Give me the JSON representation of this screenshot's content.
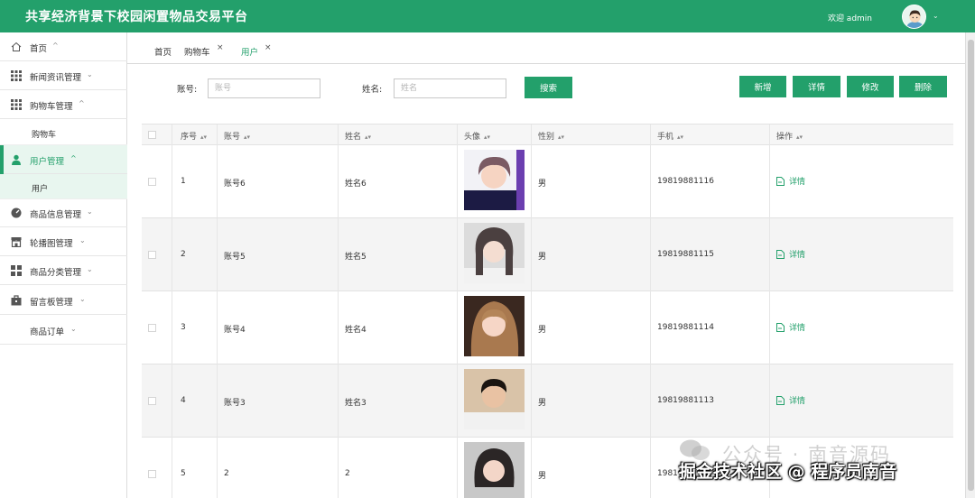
{
  "app": {
    "title": "共享经济背景下校园闲置物品交易平台",
    "welcome": "欢迎 admin"
  },
  "sidebar": {
    "items": [
      {
        "label": "首页",
        "icon": "home-icon",
        "chevron": "^"
      },
      {
        "label": "新闻资讯管理",
        "icon": "grid-icon",
        "chevron": "v"
      },
      {
        "label": "购物车管理",
        "icon": "grid-icon",
        "chevron": "^"
      },
      {
        "label": "用户管理",
        "icon": "user-icon",
        "chevron": "^"
      },
      {
        "label": "商品信息管理",
        "icon": "dashboard-icon",
        "chevron": "v"
      },
      {
        "label": "轮播图管理",
        "icon": "store-icon",
        "chevron": "v"
      },
      {
        "label": "商品分类管理",
        "icon": "tiles-icon",
        "chevron": "v"
      },
      {
        "label": "留言板管理",
        "icon": "briefcase-icon",
        "chevron": "v"
      },
      {
        "label": "商品订单",
        "icon": "",
        "chevron": "v"
      }
    ],
    "subitems": {
      "cart": "购物车",
      "user": "用户"
    }
  },
  "tabs": [
    {
      "label": "首页"
    },
    {
      "label": "购物车",
      "close": "×"
    },
    {
      "label": "用户",
      "close": "×"
    }
  ],
  "search": {
    "account_label": "账号:",
    "account_placeholder": "账号",
    "name_label": "姓名:",
    "name_placeholder": "姓名",
    "search_button": "搜索"
  },
  "actions": {
    "add": "新增",
    "detail": "详情",
    "edit": "修改",
    "delete": "删除"
  },
  "table": {
    "headers": [
      "序号",
      "账号",
      "姓名",
      "头像",
      "性别",
      "手机",
      "操作"
    ],
    "rows": [
      {
        "idx": "1",
        "account": "账号6",
        "name": "姓名6",
        "gender": "男",
        "phone": "19819881116",
        "op": "详情"
      },
      {
        "idx": "2",
        "account": "账号5",
        "name": "姓名5",
        "gender": "男",
        "phone": "19819881115",
        "op": "详情"
      },
      {
        "idx": "3",
        "account": "账号4",
        "name": "姓名4",
        "gender": "男",
        "phone": "19819881114",
        "op": "详情"
      },
      {
        "idx": "4",
        "account": "账号3",
        "name": "姓名3",
        "gender": "男",
        "phone": "19819881113",
        "op": "详情"
      },
      {
        "idx": "5",
        "account": "2",
        "name": "2",
        "gender": "男",
        "phone": "19819",
        "op": ""
      }
    ]
  },
  "watermark": {
    "line1": "公众号 · 南音源码",
    "line2": "掘金技术社区 @ 程序员南音"
  },
  "colors": {
    "primary": "#23a06b",
    "active_bg": "#e8f6ef",
    "row_alt": "#f4f4f4"
  }
}
